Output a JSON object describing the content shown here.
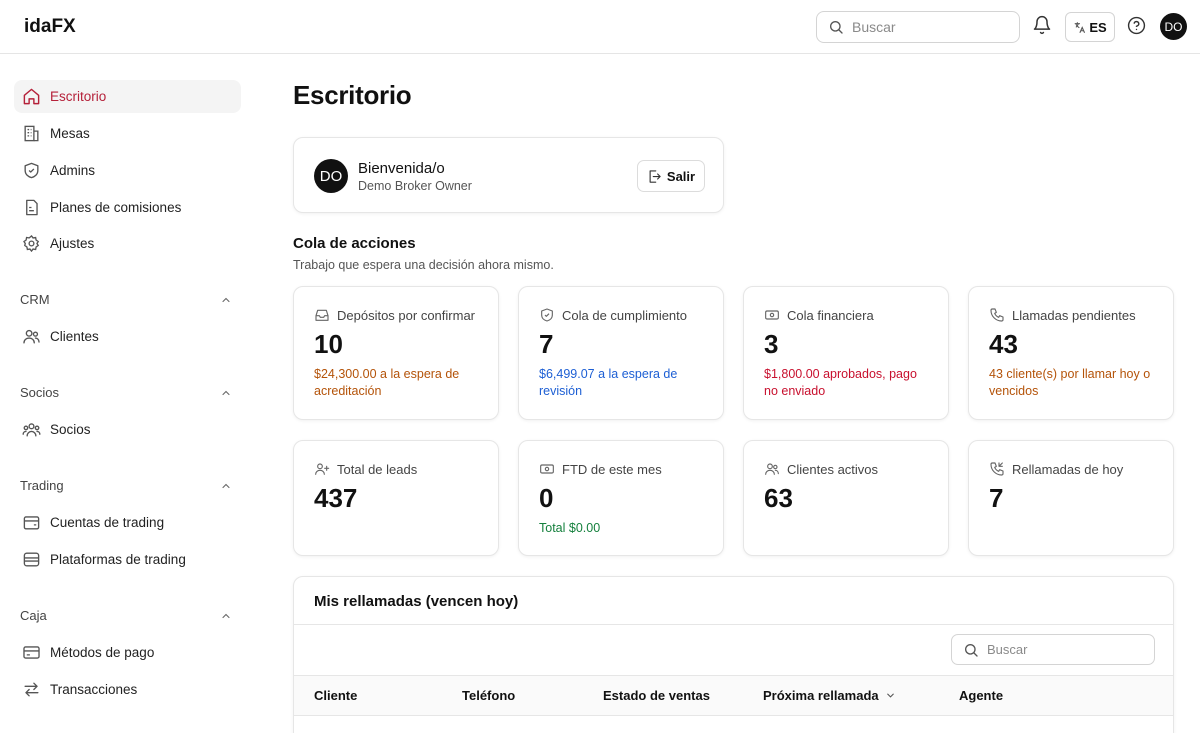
{
  "app": {
    "logo": "idaFX"
  },
  "topbar": {
    "search_placeholder": "Buscar",
    "lang": "ES",
    "user_initials": "DO"
  },
  "sidebar": {
    "items": [
      {
        "label": "Escritorio",
        "icon": "home-icon",
        "active": true
      },
      {
        "label": "Mesas",
        "icon": "building-icon"
      },
      {
        "label": "Admins",
        "icon": "shield-icon"
      },
      {
        "label": "Planes de comisiones",
        "icon": "document-icon"
      },
      {
        "label": "Ajustes",
        "icon": "gear-icon"
      }
    ],
    "sections": [
      {
        "title": "CRM",
        "items": [
          {
            "label": "Clientes",
            "icon": "users-icon"
          }
        ]
      },
      {
        "title": "Socios",
        "items": [
          {
            "label": "Socios",
            "icon": "partners-icon"
          }
        ]
      },
      {
        "title": "Trading",
        "items": [
          {
            "label": "Cuentas de trading",
            "icon": "wallet-icon"
          },
          {
            "label": "Plataformas de trading",
            "icon": "database-icon"
          }
        ]
      },
      {
        "title": "Caja",
        "items": [
          {
            "label": "Métodos de pago",
            "icon": "credit-card-icon"
          },
          {
            "label": "Transacciones",
            "icon": "arrows-exchange-icon"
          }
        ]
      }
    ]
  },
  "main": {
    "title": "Escritorio",
    "welcome": {
      "initials": "DO",
      "title": "Bienvenida/o",
      "subtitle": "Demo Broker Owner",
      "logout_label": "Salir"
    },
    "queue": {
      "title": "Cola de acciones",
      "subtitle": "Trabajo que espera una decisión ahora mismo."
    },
    "stats_row1": [
      {
        "label": "Depósitos por confirmar",
        "value": "10",
        "note": "$24,300.00 a la espera de acreditación",
        "note_color": "#b45309",
        "icon": "inbox-icon"
      },
      {
        "label": "Cola de cumplimiento",
        "value": "7",
        "note": "$6,499.07 a la espera de revisión",
        "note_color": "#1d5fd4",
        "icon": "shield-check-icon"
      },
      {
        "label": "Cola financiera",
        "value": "3",
        "note": "$1,800.00 aprobados, pago no enviado",
        "note_color": "#c8102e",
        "icon": "banknote-icon"
      },
      {
        "label": "Llamadas pendientes",
        "value": "43",
        "note": "43 cliente(s) por llamar hoy o vencidos",
        "note_color": "#b45309",
        "icon": "phone-icon"
      }
    ],
    "stats_row2": [
      {
        "label": "Total de leads",
        "value": "437",
        "note": "",
        "icon": "user-plus-icon"
      },
      {
        "label": "FTD de este mes",
        "value": "0",
        "note": "Total $0.00",
        "note_color": "#15803d",
        "icon": "banknote-icon"
      },
      {
        "label": "Clientes activos",
        "value": "63",
        "note": "",
        "icon": "users-icon"
      },
      {
        "label": "Rellamadas de hoy",
        "value": "7",
        "note": "",
        "icon": "phone-callback-icon"
      }
    ],
    "callbacks": {
      "title": "Mis rellamadas (vencen hoy)",
      "search_placeholder": "Buscar",
      "columns": [
        "Cliente",
        "Teléfono",
        "Estado de ventas",
        "Próxima rellamada",
        "Agente"
      ]
    }
  }
}
